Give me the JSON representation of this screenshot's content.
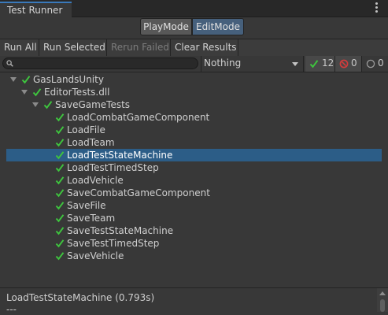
{
  "window": {
    "tab_title": "Test Runner"
  },
  "modes": {
    "play": "PlayMode",
    "edit": "EditMode",
    "active": "EditMode"
  },
  "toolbar": {
    "run_all": "Run All",
    "run_selected": "Run Selected",
    "rerun_failed": "Rerun Failed",
    "clear_results": "Clear Results"
  },
  "filter": {
    "search_value": "",
    "category_selected": "Nothing",
    "passed_count": "12",
    "failed_count": "0",
    "skipped_count": "0"
  },
  "tree": {
    "root": "GasLandsUnity",
    "assembly": "EditorTests.dll",
    "fixture": "SaveGameTests",
    "tests": [
      "LoadCombatGameComponent",
      "LoadFile",
      "LoadTeam",
      "LoadTestStateMachine",
      "LoadTestTimedStep",
      "LoadVehicle",
      "SaveCombatGameComponent",
      "SaveFile",
      "SaveTeam",
      "SaveTestStateMachine",
      "SaveTestTimedStep",
      "SaveVehicle"
    ],
    "selected": "LoadTestStateMachine"
  },
  "details": {
    "title": "LoadTestStateMachine (0.793s)",
    "separator": "---"
  },
  "colors": {
    "pass": "#3ec43e",
    "fail": "#d33c3c",
    "selection": "#2c5d87",
    "accent": "#3a79bb"
  },
  "icons": {
    "search": "search-icon",
    "pass": "check-icon",
    "fail": "fail-icon",
    "skip": "skip-icon",
    "menu": "kebab-menu-icon"
  }
}
